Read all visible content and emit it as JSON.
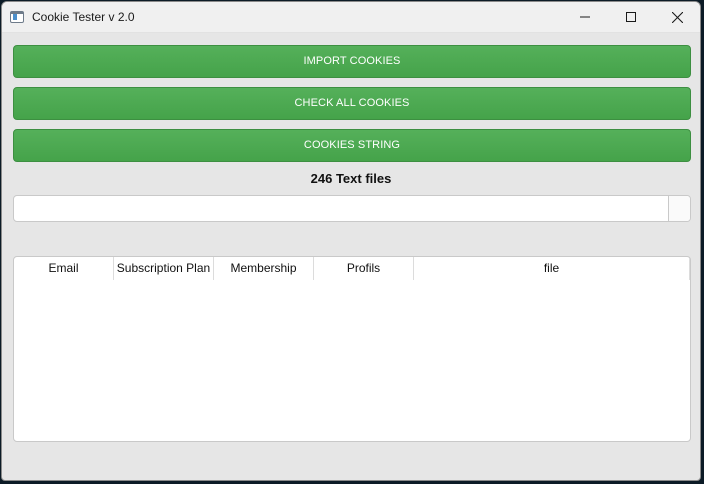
{
  "window": {
    "title": "Cookie Tester v 2.0",
    "icons": {
      "app": "app-window-icon",
      "minimize": "minimize-icon",
      "maximize": "maximize-icon",
      "close": "close-icon"
    }
  },
  "buttons": {
    "import": "IMPORT COOKIES",
    "check_all": "CHECK ALL COOKIES",
    "cookies_string": "COOKIES STRING"
  },
  "file_count_label": "246 Text files",
  "progress": {
    "value": 0
  },
  "table": {
    "columns": [
      "Email",
      "Subscription Plan",
      "Membership",
      "Profils",
      "file"
    ],
    "rows": []
  },
  "colors": {
    "accent": "#4caf50",
    "window_bg": "#e6e6e6"
  }
}
